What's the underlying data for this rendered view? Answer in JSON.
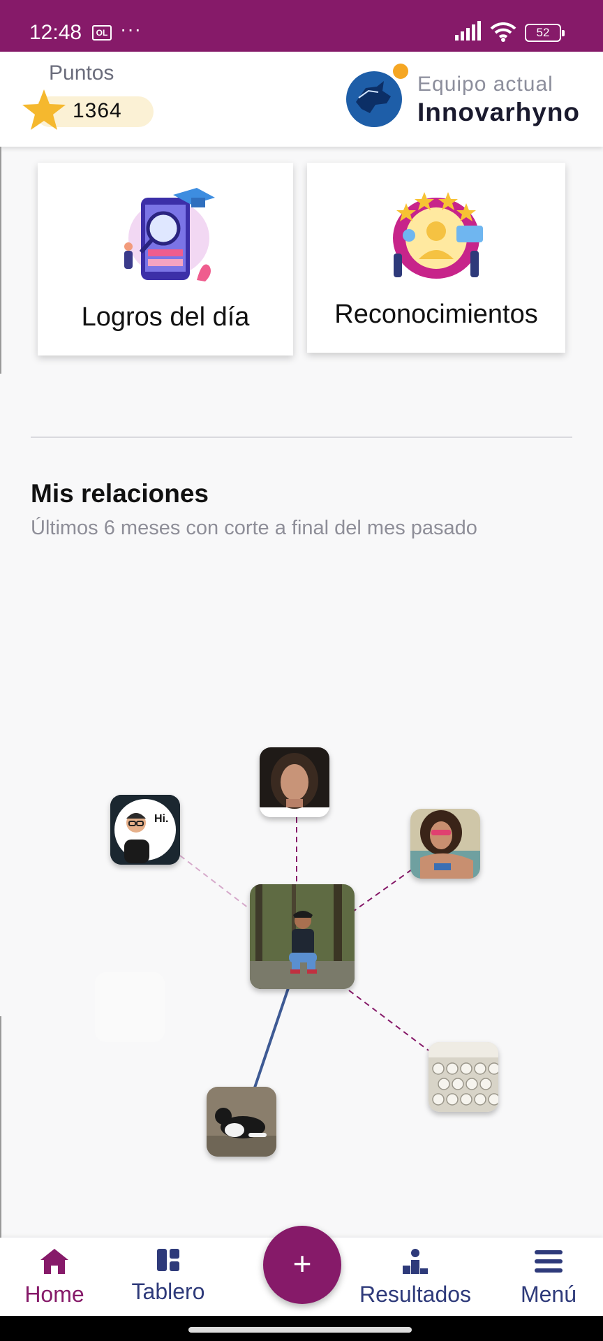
{
  "status_bar": {
    "time": "12:48",
    "notification_icon_text": "OL",
    "overflow": "···",
    "battery": "52"
  },
  "header": {
    "points_label": "Puntos",
    "points_value": "1364",
    "team_label": "Equipo actual",
    "team_name": "Innovarhyno"
  },
  "cards": [
    {
      "title": "Logros del día",
      "icon": "achievements-illustration"
    },
    {
      "title": "Reconocimientos",
      "icon": "recognitions-illustration"
    }
  ],
  "relations": {
    "title": "Mis relaciones",
    "subtitle": "Últimos 6 meses con corte a final del mes pasado",
    "avatar_badge_text": "Hi.",
    "nodes": [
      "center-user",
      "woman-curly-hair",
      "bitmoji-man",
      "woman-sunglasses",
      "keyboard-photo",
      "dog-photo"
    ]
  },
  "bottom_nav": {
    "items": [
      {
        "label": "Home",
        "icon": "home-icon"
      },
      {
        "label": "Tablero",
        "icon": "dashboard-icon"
      },
      {
        "label": "Resultados",
        "icon": "podium-icon"
      },
      {
        "label": "Menú",
        "icon": "menu-icon"
      }
    ],
    "fab_label": "+"
  },
  "colors": {
    "brand": "#861a69",
    "nav_text": "#2e3a7a",
    "star": "#f5b82e"
  }
}
